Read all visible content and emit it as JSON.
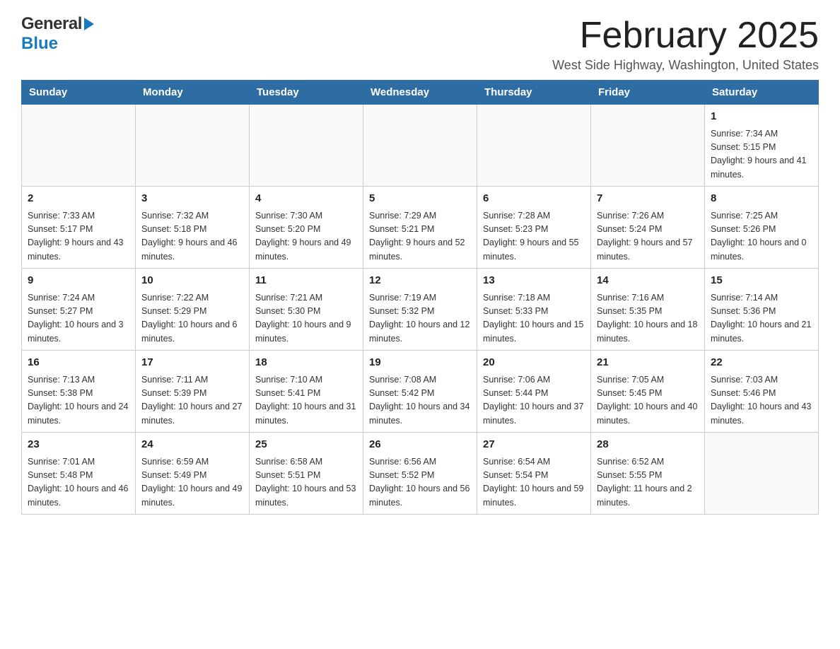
{
  "header": {
    "logo_general": "General",
    "logo_blue": "Blue",
    "month_title": "February 2025",
    "subtitle": "West Side Highway, Washington, United States"
  },
  "days_of_week": [
    "Sunday",
    "Monday",
    "Tuesday",
    "Wednesday",
    "Thursday",
    "Friday",
    "Saturday"
  ],
  "weeks": [
    [
      {
        "day": "",
        "info": ""
      },
      {
        "day": "",
        "info": ""
      },
      {
        "day": "",
        "info": ""
      },
      {
        "day": "",
        "info": ""
      },
      {
        "day": "",
        "info": ""
      },
      {
        "day": "",
        "info": ""
      },
      {
        "day": "1",
        "info": "Sunrise: 7:34 AM\nSunset: 5:15 PM\nDaylight: 9 hours and 41 minutes."
      }
    ],
    [
      {
        "day": "2",
        "info": "Sunrise: 7:33 AM\nSunset: 5:17 PM\nDaylight: 9 hours and 43 minutes."
      },
      {
        "day": "3",
        "info": "Sunrise: 7:32 AM\nSunset: 5:18 PM\nDaylight: 9 hours and 46 minutes."
      },
      {
        "day": "4",
        "info": "Sunrise: 7:30 AM\nSunset: 5:20 PM\nDaylight: 9 hours and 49 minutes."
      },
      {
        "day": "5",
        "info": "Sunrise: 7:29 AM\nSunset: 5:21 PM\nDaylight: 9 hours and 52 minutes."
      },
      {
        "day": "6",
        "info": "Sunrise: 7:28 AM\nSunset: 5:23 PM\nDaylight: 9 hours and 55 minutes."
      },
      {
        "day": "7",
        "info": "Sunrise: 7:26 AM\nSunset: 5:24 PM\nDaylight: 9 hours and 57 minutes."
      },
      {
        "day": "8",
        "info": "Sunrise: 7:25 AM\nSunset: 5:26 PM\nDaylight: 10 hours and 0 minutes."
      }
    ],
    [
      {
        "day": "9",
        "info": "Sunrise: 7:24 AM\nSunset: 5:27 PM\nDaylight: 10 hours and 3 minutes."
      },
      {
        "day": "10",
        "info": "Sunrise: 7:22 AM\nSunset: 5:29 PM\nDaylight: 10 hours and 6 minutes."
      },
      {
        "day": "11",
        "info": "Sunrise: 7:21 AM\nSunset: 5:30 PM\nDaylight: 10 hours and 9 minutes."
      },
      {
        "day": "12",
        "info": "Sunrise: 7:19 AM\nSunset: 5:32 PM\nDaylight: 10 hours and 12 minutes."
      },
      {
        "day": "13",
        "info": "Sunrise: 7:18 AM\nSunset: 5:33 PM\nDaylight: 10 hours and 15 minutes."
      },
      {
        "day": "14",
        "info": "Sunrise: 7:16 AM\nSunset: 5:35 PM\nDaylight: 10 hours and 18 minutes."
      },
      {
        "day": "15",
        "info": "Sunrise: 7:14 AM\nSunset: 5:36 PM\nDaylight: 10 hours and 21 minutes."
      }
    ],
    [
      {
        "day": "16",
        "info": "Sunrise: 7:13 AM\nSunset: 5:38 PM\nDaylight: 10 hours and 24 minutes."
      },
      {
        "day": "17",
        "info": "Sunrise: 7:11 AM\nSunset: 5:39 PM\nDaylight: 10 hours and 27 minutes."
      },
      {
        "day": "18",
        "info": "Sunrise: 7:10 AM\nSunset: 5:41 PM\nDaylight: 10 hours and 31 minutes."
      },
      {
        "day": "19",
        "info": "Sunrise: 7:08 AM\nSunset: 5:42 PM\nDaylight: 10 hours and 34 minutes."
      },
      {
        "day": "20",
        "info": "Sunrise: 7:06 AM\nSunset: 5:44 PM\nDaylight: 10 hours and 37 minutes."
      },
      {
        "day": "21",
        "info": "Sunrise: 7:05 AM\nSunset: 5:45 PM\nDaylight: 10 hours and 40 minutes."
      },
      {
        "day": "22",
        "info": "Sunrise: 7:03 AM\nSunset: 5:46 PM\nDaylight: 10 hours and 43 minutes."
      }
    ],
    [
      {
        "day": "23",
        "info": "Sunrise: 7:01 AM\nSunset: 5:48 PM\nDaylight: 10 hours and 46 minutes."
      },
      {
        "day": "24",
        "info": "Sunrise: 6:59 AM\nSunset: 5:49 PM\nDaylight: 10 hours and 49 minutes."
      },
      {
        "day": "25",
        "info": "Sunrise: 6:58 AM\nSunset: 5:51 PM\nDaylight: 10 hours and 53 minutes."
      },
      {
        "day": "26",
        "info": "Sunrise: 6:56 AM\nSunset: 5:52 PM\nDaylight: 10 hours and 56 minutes."
      },
      {
        "day": "27",
        "info": "Sunrise: 6:54 AM\nSunset: 5:54 PM\nDaylight: 10 hours and 59 minutes."
      },
      {
        "day": "28",
        "info": "Sunrise: 6:52 AM\nSunset: 5:55 PM\nDaylight: 11 hours and 2 minutes."
      },
      {
        "day": "",
        "info": ""
      }
    ]
  ]
}
